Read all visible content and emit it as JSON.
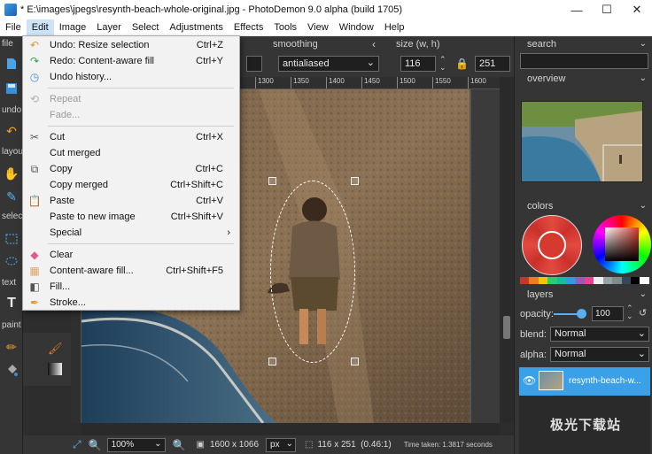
{
  "window": {
    "title": "* E:\\images\\jpegs\\resynth-beach-whole-original.jpg - PhotoDemon 9.0 alpha (build 1705)",
    "min": "—",
    "max": "☐",
    "close": "✕"
  },
  "menubar": [
    "File",
    "Edit",
    "Image",
    "Layer",
    "Select",
    "Adjustments",
    "Effects",
    "Tools",
    "View",
    "Window",
    "Help"
  ],
  "left_toolbar": {
    "sections": [
      "file",
      "undo",
      "layout",
      "select",
      "text",
      "paint"
    ]
  },
  "tool_options": {
    "smoothing_label": "smoothing",
    "smoothing_value": "antialiased",
    "size_label": "size (w, h)",
    "width": "116",
    "height": "251"
  },
  "ruler_ticks": [
    "1300",
    "1350",
    "1400",
    "1450",
    "1500",
    "1550",
    "1600"
  ],
  "edit_menu": {
    "items": [
      {
        "label": "Undo: Resize selection",
        "shortcut": "Ctrl+Z",
        "icon": "undo-icon",
        "disabled": false
      },
      {
        "label": "Redo: Content-aware fill",
        "shortcut": "Ctrl+Y",
        "icon": "redo-icon",
        "disabled": false
      },
      {
        "label": "Undo history...",
        "shortcut": "",
        "icon": "history-icon",
        "disabled": false
      },
      {
        "label": "Repeat",
        "shortcut": "",
        "icon": "repeat-icon",
        "disabled": true
      },
      {
        "label": "Fade...",
        "shortcut": "",
        "icon": "",
        "disabled": true
      },
      {
        "label": "Cut",
        "shortcut": "Ctrl+X",
        "icon": "scissors-icon",
        "disabled": false
      },
      {
        "label": "Cut merged",
        "shortcut": "",
        "icon": "",
        "disabled": false
      },
      {
        "label": "Copy",
        "shortcut": "Ctrl+C",
        "icon": "copy-icon",
        "disabled": false
      },
      {
        "label": "Copy merged",
        "shortcut": "Ctrl+Shift+C",
        "icon": "",
        "disabled": false
      },
      {
        "label": "Paste",
        "shortcut": "Ctrl+V",
        "icon": "paste-icon",
        "disabled": false
      },
      {
        "label": "Paste to new image",
        "shortcut": "Ctrl+Shift+V",
        "icon": "",
        "disabled": false
      },
      {
        "label": "Special",
        "shortcut": "›",
        "icon": "",
        "disabled": false
      },
      {
        "label": "Clear",
        "shortcut": "",
        "icon": "eraser-icon",
        "disabled": false
      },
      {
        "label": "Content-aware fill...",
        "shortcut": "Ctrl+Shift+F5",
        "icon": "content-fill-icon",
        "disabled": false
      },
      {
        "label": "Fill...",
        "shortcut": "",
        "icon": "bucket-icon",
        "disabled": false
      },
      {
        "label": "Stroke...",
        "shortcut": "",
        "icon": "stroke-icon",
        "disabled": false
      }
    ]
  },
  "right_panel": {
    "search_label": "search",
    "overview_label": "overview",
    "colors_label": "colors",
    "layers_label": "layers",
    "opacity_label": "opacity:",
    "opacity_value": "100",
    "blend_label": "blend:",
    "blend_value": "Normal",
    "alpha_label": "alpha:",
    "alpha_value": "Normal",
    "layer_name": "resynth-beach-w..."
  },
  "statusbar": {
    "zoom": "100%",
    "image_size": "1600 x 1066",
    "unit": "px",
    "selection_size": "116 x 251  (0.46:1)",
    "time": "Time taken: 1.3817 seconds"
  },
  "colors": {
    "accent": "#3aa0e8",
    "primary_color": "#d63a2e",
    "menu_bg": "#f2f2f2"
  },
  "palette": [
    "#c0392b",
    "#e67e22",
    "#f1c40f",
    "#2ecc71",
    "#1abc9c",
    "#3498db",
    "#9b59b6",
    "#e84393",
    "#ecf0f1",
    "#95a5a6",
    "#7f8c8d",
    "#34495e",
    "#000000",
    "#ffffff"
  ],
  "watermark": "极光下载站"
}
